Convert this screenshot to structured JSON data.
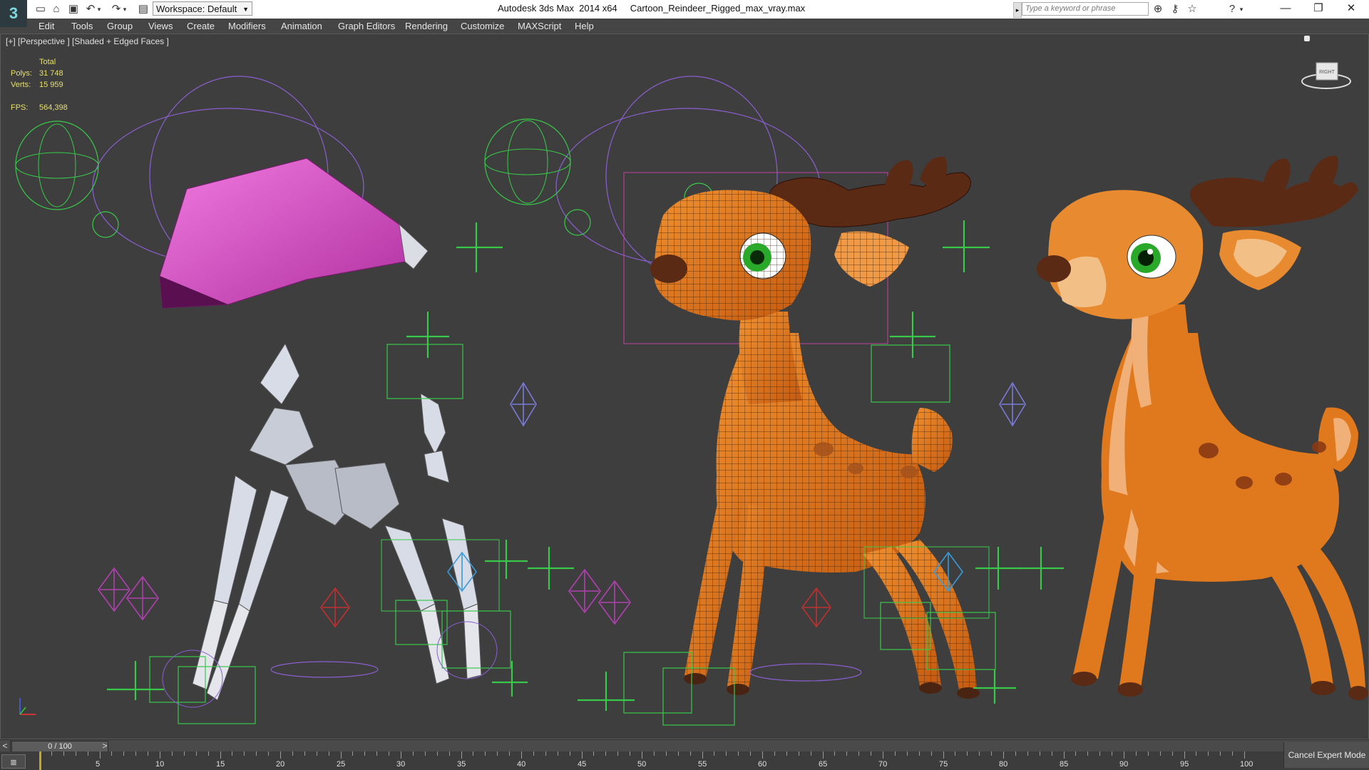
{
  "titlebar": {
    "workspace_label": "Workspace: Default",
    "app_name": "Autodesk 3ds Max  2014 x64",
    "file_name": "Cartoon_Reindeer_Rigged_max_vray.max",
    "search_placeholder": "Type a keyword or phrase",
    "icons": [
      "app-logo",
      "new-file-icon",
      "open-folder-icon",
      "save-icon",
      "undo-icon",
      "redo-icon",
      "project-folder-icon",
      "binoculars-icon",
      "key-icon",
      "star-icon",
      "help-icon",
      "minimize-icon",
      "restore-icon",
      "close-icon"
    ]
  },
  "menu": {
    "items": [
      "Edit",
      "Tools",
      "Group",
      "Views",
      "Create",
      "Modifiers",
      "Animation",
      "Graph Editors",
      "Rendering",
      "Customize",
      "MAXScript",
      "Help"
    ]
  },
  "viewport": {
    "label": "[+] [Perspective ] [Shaded + Edged Faces ]",
    "stats": {
      "total_label": "Total",
      "polys_label": "Polys:",
      "polys_value": "31 748",
      "verts_label": "Verts:",
      "verts_value": "15 959",
      "fps_label": "FPS:",
      "fps_value": "564,398"
    },
    "viewcube_label": "RIGHT",
    "colors": {
      "background": "#3e3e3e",
      "stats_text": "#e8e06a",
      "rig_green": "#39c94a",
      "rig_purple": "#8a5fd0",
      "mesh_orange": "#e0781e",
      "antler": "#5a2a14",
      "bone": "#d8dce6",
      "head_box": "#e060d0"
    }
  },
  "timeline": {
    "frame_display": "0 / 100",
    "current_frame": 0,
    "total_frames": 100,
    "ticks": [
      "5",
      "10",
      "15",
      "20",
      "25",
      "30",
      "35",
      "40",
      "45",
      "50",
      "55",
      "60",
      "65",
      "70",
      "75",
      "80",
      "85",
      "90",
      "95",
      "100"
    ]
  },
  "statusbar": {
    "cancel_expert_label": "Cancel Expert Mode"
  }
}
